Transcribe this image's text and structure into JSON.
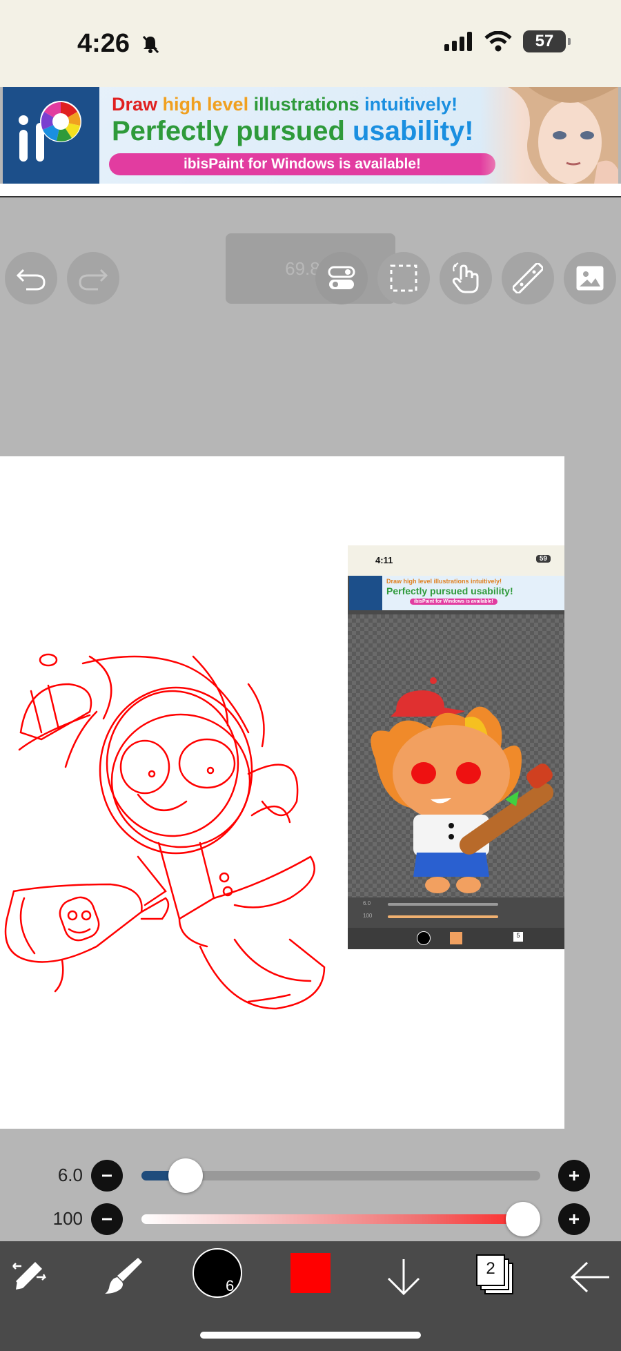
{
  "status_bar": {
    "time": "4:26",
    "battery": "57"
  },
  "ad_banner": {
    "line1_word1": "Draw",
    "line1_word2": "high level",
    "line1_word3": "illustrations",
    "line1_word4": "intuitively!",
    "line2_word1": "Perfectly pursued",
    "line2_word2": "usability!",
    "line3": "ibisPaint for Windows is available!",
    "colors": {
      "red": "#e02020",
      "orange": "#f0a020",
      "green": "#2e9a3a",
      "blue": "#1a8fe0",
      "pink": "#e23ca0"
    }
  },
  "toolbar": {
    "zoom": "69.8%",
    "icons": [
      "undo-icon",
      "redo-icon",
      "toggle-icon",
      "selection-icon",
      "hand-icon",
      "ruler-icon",
      "image-icon"
    ]
  },
  "canvas": {
    "stroke_color": "#ff0000",
    "embedded_screenshot": {
      "time": "4:11",
      "battery": "59",
      "ad_line1": "Draw high level illustrations intuitively!",
      "ad_line2": "Perfectly pursued usability!",
      "ad_line3": "ibisPaint for Windows is available!",
      "slider1_value": "6.0",
      "slider2_value": "100",
      "layer_count": "5"
    }
  },
  "sliders": {
    "brush_size": {
      "value": "6.0",
      "level": 0.11,
      "fill_color": "#1f4c7c"
    },
    "opacity": {
      "value": "100",
      "level": 1.0
    }
  },
  "bottom_bar": {
    "brush_size_badge": "6",
    "current_color": "#ff0000",
    "layer_count": "2",
    "icons": [
      "transform-icon",
      "brush-icon",
      "color-circle-icon",
      "color-swatch-icon",
      "down-arrow-icon",
      "layers-icon",
      "back-arrow-icon"
    ]
  }
}
